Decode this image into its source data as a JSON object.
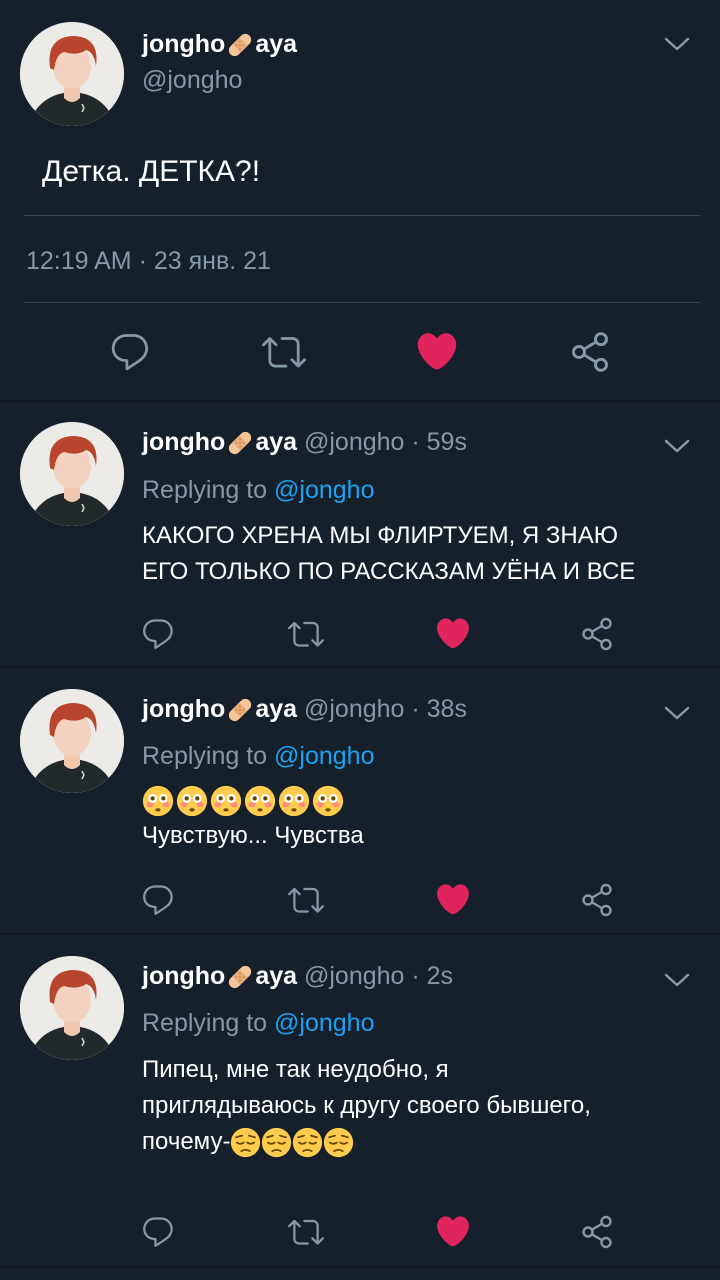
{
  "main_tweet": {
    "name_prefix": "jongho",
    "name_suffix": "aya",
    "handle": "@jongho",
    "text": "Детка. ДЕТКА?!",
    "timestamp": "12:19 AM · 23 янв. 21",
    "liked": true
  },
  "replies": [
    {
      "name_prefix": "jongho",
      "name_suffix": "aya",
      "handle_time": "@jongho · 59s",
      "replying_label": "Replying to",
      "replying_handle": "@jongho",
      "line1": "КАКОГО ХРЕНА МЫ ФЛИРТУЕМ, Я ЗНАЮ",
      "line2": "ЕГО ТОЛЬКО ПО РАССКАЗАМ УЁНА И ВСЕ"
    },
    {
      "name_prefix": "jongho",
      "name_suffix": "aya",
      "handle_time": "@jongho · 38s",
      "replying_label": "Replying to",
      "replying_handle": "@jongho",
      "emoji": "flushed-face x6",
      "line2": "Чувствую... Чувства"
    },
    {
      "name_prefix": "jongho",
      "name_suffix": "aya",
      "handle_time": "@jongho · 2s",
      "replying_label": "Replying to",
      "replying_handle": "@jongho",
      "line1": "Пипец, мне так неудобно, я",
      "line2": "приглядываюсь к другу своего бывшего,",
      "line3": "почему-",
      "emoji": "pensive-face x4"
    }
  ],
  "colors": {
    "background": "#15202b",
    "secondary_text": "#8899a6",
    "link": "#1da1f2",
    "like": "#e0245e"
  },
  "icons": [
    "reply-icon",
    "retweet-icon",
    "like-heart-icon",
    "share-icon",
    "chevron-down-icon",
    "bandage-icon"
  ]
}
